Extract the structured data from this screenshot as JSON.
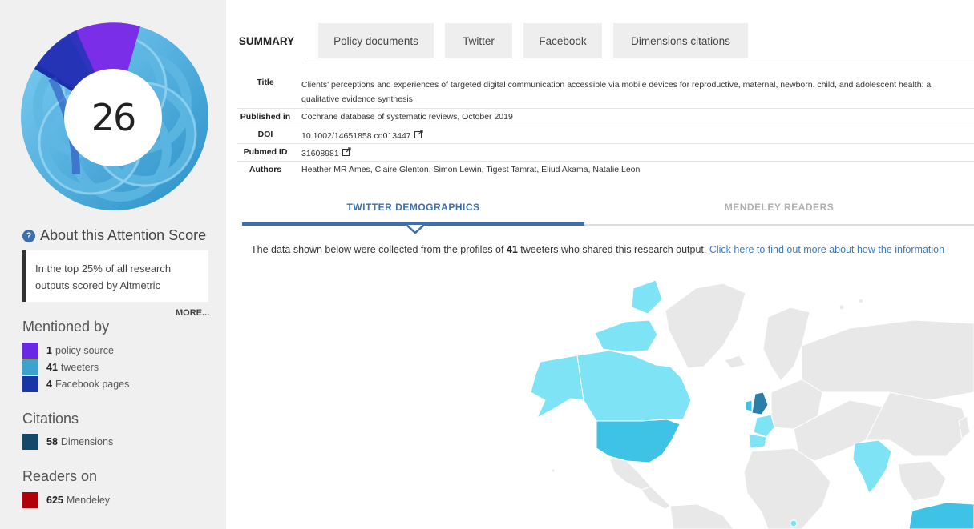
{
  "sidebar": {
    "score": "26",
    "about_title": "About this Attention Score",
    "about_icon": "question-icon",
    "top_text": "In the top 25% of all research outputs scored by Altmetric",
    "more_label": "MORE...",
    "mentioned_title": "Mentioned by",
    "mentioned": [
      {
        "count": "1",
        "label": "policy source",
        "color": "#6b27e6"
      },
      {
        "count": "41",
        "label": "tweeters",
        "color": "#3ea2cf"
      },
      {
        "count": "4",
        "label": "Facebook pages",
        "color": "#1a35a6"
      }
    ],
    "citations_title": "Citations",
    "citations": [
      {
        "count": "58",
        "label": "Dimensions",
        "color": "#16486b"
      }
    ],
    "readers_title": "Readers on",
    "readers": [
      {
        "count": "625",
        "label": "Mendeley",
        "color": "#b0000b"
      }
    ]
  },
  "tabs": [
    "SUMMARY",
    "Policy documents",
    "Twitter",
    "Facebook",
    "Dimensions citations"
  ],
  "meta": {
    "title_label": "Title",
    "title_line1": "Clients' perceptions and experiences of targeted digital communication accessible via mobile devices for reproductive, maternal, newborn, child, and adolescent health: a",
    "title_line2": "qualitative evidence synthesis",
    "published_label": "Published in",
    "published_value": "Cochrane database of systematic reviews, October 2019",
    "doi_label": "DOI",
    "doi_value": "10.1002/14651858.cd013447",
    "pubmed_label": "Pubmed ID",
    "pubmed_value": "31608981",
    "authors_label": "Authors",
    "authors_value": "Heather MR Ames, Claire Glenton, Simon Lewin, Tigest Tamrat, Eliud Akama, Natalie Leon"
  },
  "demographics": {
    "tab_twitter": "TWITTER DEMOGRAPHICS",
    "tab_mendeley": "MENDELEY READERS",
    "desc_before": "The data shown below were collected from the profiles of ",
    "desc_count": "41",
    "desc_after": " tweeters who shared this research output. ",
    "desc_link": "Click here to find out more about how the information"
  },
  "map_colors": {
    "none": "#e8e8e8",
    "low": "#7fe3f6",
    "mid": "#3ec3e6",
    "high": "#2a7ea8"
  }
}
